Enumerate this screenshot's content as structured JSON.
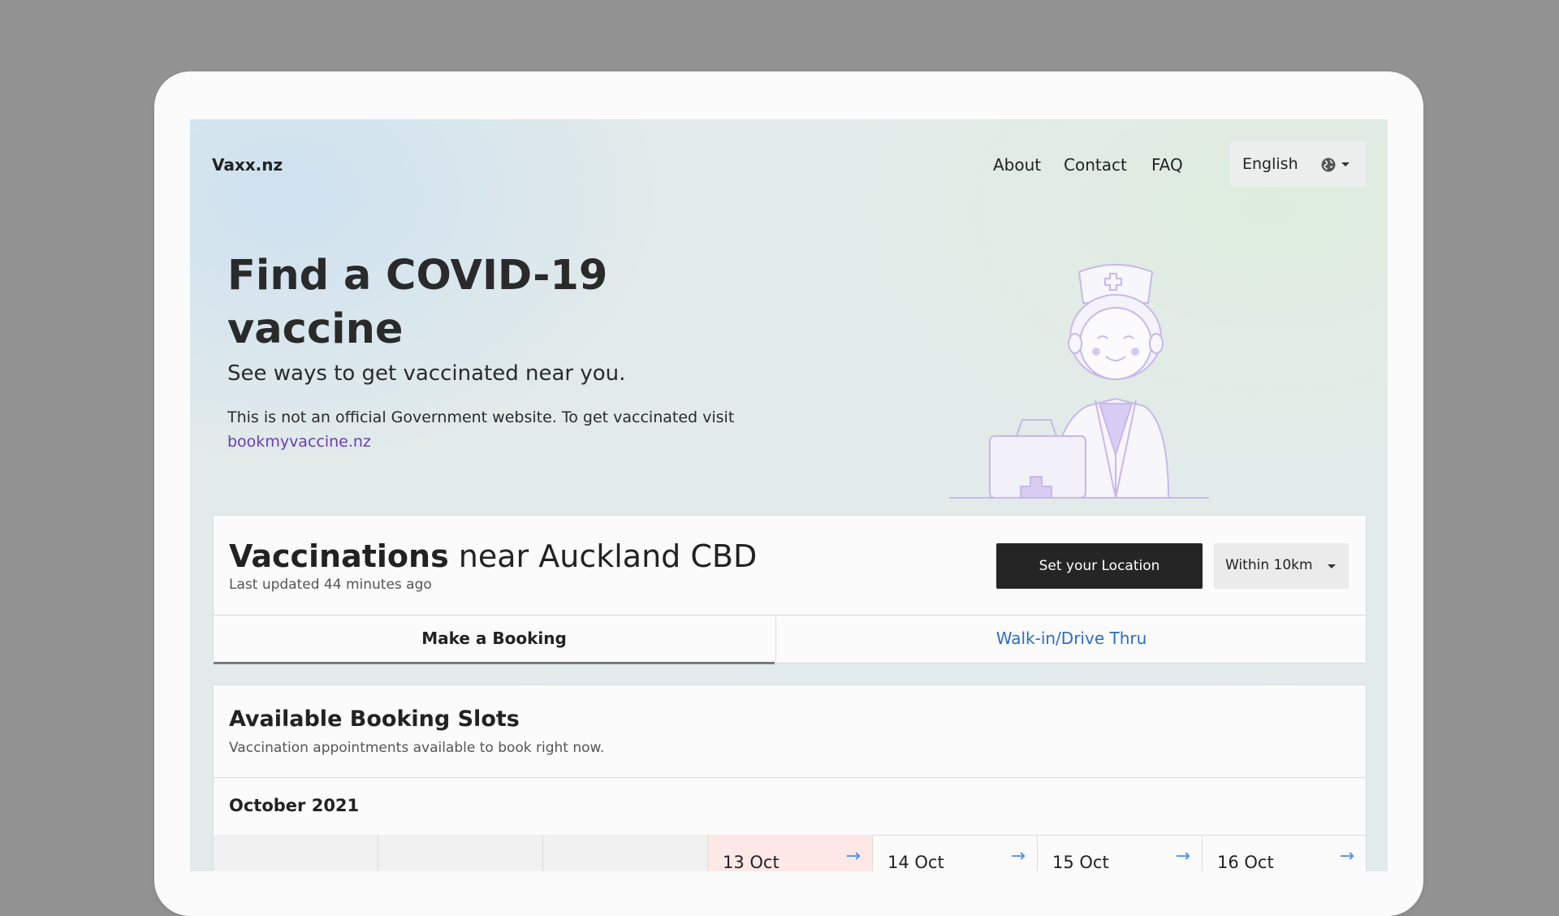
{
  "nav": {
    "brand": "Vaxx.nz",
    "links": [
      "About",
      "Contact",
      "FAQ"
    ],
    "language": "English"
  },
  "hero": {
    "title": "Find a COVID-19 vaccine",
    "subtitle": "See ways to get vaccinated near you.",
    "note": "This is not an official Government website. To get vaccinated visit",
    "note_link": "bookmyvaccine.nz"
  },
  "vaccinations": {
    "title_bold": "Vaccinations",
    "title_rest": " near Auckland CBD",
    "updated": "Last updated 44 minutes ago",
    "set_location": "Set your Location",
    "radius": "Within 10km",
    "tabs": [
      "Make a Booking",
      "Walk-in/Drive Thru"
    ]
  },
  "slots": {
    "title": "Available Booking Slots",
    "subtitle": "Vaccination appointments available to book right now.",
    "month": "October 2021",
    "days": [
      "13 Oct",
      "14 Oct",
      "15 Oct",
      "16 Oct"
    ],
    "arrow": "→"
  },
  "colors": {
    "link_purple": "#6a3db4",
    "tab_blue": "#2d6cc4",
    "today_bg": "#fde8e6",
    "button_dark": "#252525"
  }
}
